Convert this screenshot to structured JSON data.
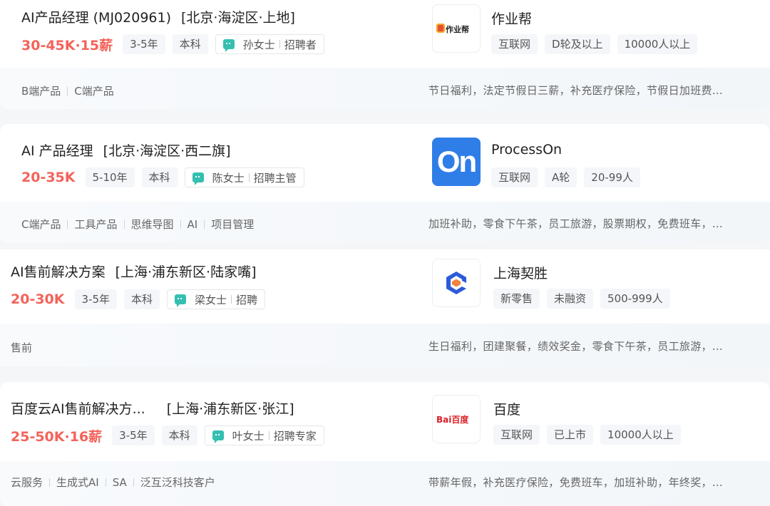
{
  "jobs": [
    {
      "title": "AI产品经理 (MJ020961)",
      "location": "[北京·海淀区·上地]",
      "salary": "30-45K·15薪",
      "experience": "3-5年",
      "education": "本科",
      "recruiter_name": "孙女士",
      "recruiter_role": "招聘者",
      "company": "作业帮",
      "company_tags": [
        "互联网",
        "D轮及以上",
        "10000人以上"
      ],
      "skills": [
        "B端产品",
        "C端产品"
      ],
      "welfare": "节日福利，法定节假日三薪，补充医疗保险，节假日加班费…",
      "logo_text": "作业帮"
    },
    {
      "title": "AI 产品经理",
      "location": "[北京·海淀区·西二旗]",
      "salary": "20-35K",
      "experience": "5-10年",
      "education": "本科",
      "recruiter_name": "陈女士",
      "recruiter_role": "招聘主管",
      "company": "ProcessOn",
      "company_tags": [
        "互联网",
        "A轮",
        "20-99人"
      ],
      "skills": [
        "C端产品",
        "工具产品",
        "思维导图",
        "AI",
        "项目管理"
      ],
      "welfare": "加班补助，零食下午茶，员工旅游，股票期权，免费班车，…",
      "logo_text": "On"
    },
    {
      "title": "AI售前解决方案",
      "location": "[上海·浦东新区·陆家嘴]",
      "salary": "20-30K",
      "experience": "3-5年",
      "education": "本科",
      "recruiter_name": "梁女士",
      "recruiter_role": "招聘",
      "company": "上海契胜",
      "company_tags": [
        "新零售",
        "未融资",
        "500-999人"
      ],
      "skills": [
        "售前"
      ],
      "welfare": "生日福利，团建聚餐，绩效奖金，零食下午茶，员工旅游，…"
    },
    {
      "title": "百度云AI售前解决方...",
      "location": "[上海·浦东新区·张江]",
      "salary": "25-50K·16薪",
      "experience": "3-5年",
      "education": "本科",
      "recruiter_name": "叶女士",
      "recruiter_role": "招聘专家",
      "company": "百度",
      "company_tags": [
        "互联网",
        "已上市",
        "10000人以上"
      ],
      "skills": [
        "云服务",
        "生成式AI",
        "SA",
        "泛互泛科技客户"
      ],
      "welfare": "带薪年假，补充医疗保险，免费班车，加班补助，年终奖，…",
      "logo_text": "Bai百度"
    }
  ],
  "colors": {
    "salary": "#f4635a",
    "recruiter_icon": "#34bfb1",
    "processon_blue": "#2f7ee8",
    "baidu_red": "#de1f26",
    "baidu_blue": "#2932e1"
  }
}
